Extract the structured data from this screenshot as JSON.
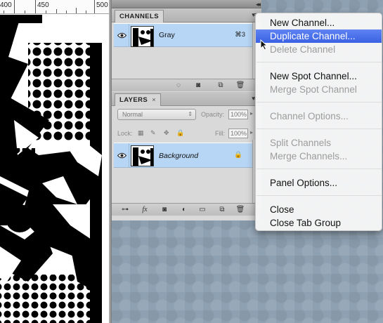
{
  "ruler": {
    "labels": [
      "400",
      "450",
      "500"
    ]
  },
  "channels_panel": {
    "tab_label": "CHANNELS",
    "channel": {
      "name": "Gray",
      "shortcut": "⌘3"
    }
  },
  "layers_panel": {
    "tab_label": "LAYERS",
    "blend_mode": "Normal",
    "opacity_label": "Opacity:",
    "opacity_value": "100%",
    "lock_label": "Lock:",
    "fill_label": "Fill:",
    "fill_value": "100%",
    "layer": {
      "name": "Background"
    },
    "footer_fx_label": "fx"
  },
  "flyout_menu": {
    "items": [
      {
        "label": "New Channel...",
        "enabled": true
      },
      {
        "label": "Duplicate Channel...",
        "enabled": true,
        "highlighted": true
      },
      {
        "label": "Delete Channel",
        "enabled": false
      },
      {
        "label": "New Spot Channel...",
        "enabled": true
      },
      {
        "label": "Merge Spot Channel",
        "enabled": false
      },
      {
        "label": "Channel Options...",
        "enabled": false
      },
      {
        "label": "Split Channels",
        "enabled": false
      },
      {
        "label": "Merge Channels...",
        "enabled": false
      },
      {
        "label": "Panel Options...",
        "enabled": true
      },
      {
        "label": "Close",
        "enabled": true
      },
      {
        "label": "Close Tab Group",
        "enabled": true
      }
    ]
  },
  "colors": {
    "selection_blue": "#b7d6f5",
    "menu_highlight": "#3a61e3",
    "workspace_bg": "#8ea1b2",
    "panel_bg": "#d9d9d9"
  }
}
